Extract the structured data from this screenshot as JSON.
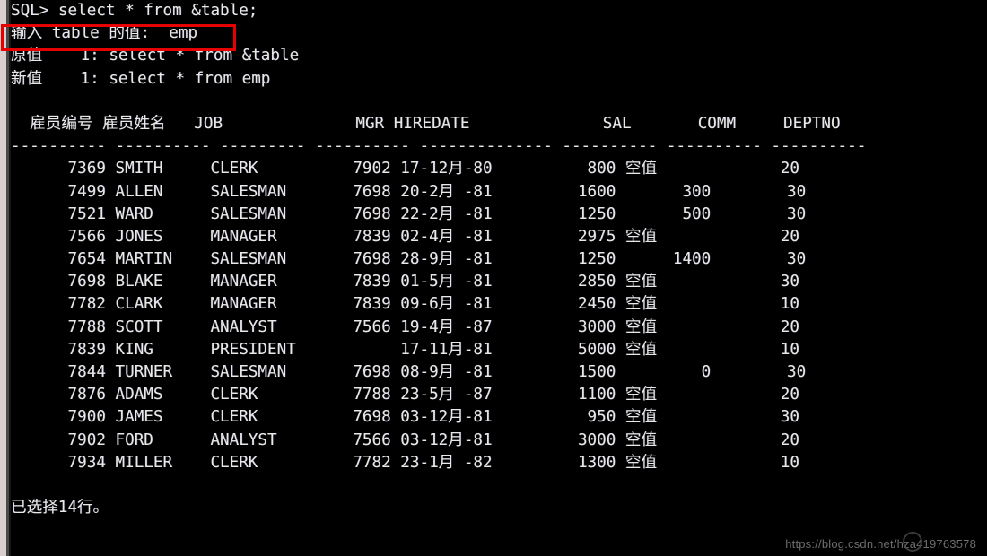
{
  "terminal": {
    "prompt_line": "SQL> select * from &table;",
    "substitution_prompt": "输入 table 的值:  emp",
    "old_value_line": "原值    1: select * from &table",
    "new_value_line": "新值    1: select * from emp",
    "blank_line": "",
    "status_line": "已选择14行。",
    "null_display": "空值",
    "background_color": "#000000",
    "text_color": "#e8e8e8",
    "highlight_color": "#e60000"
  },
  "table": {
    "columns": [
      {
        "name": "雇员编号",
        "width": 10,
        "align": "right"
      },
      {
        "name": "雇员姓名",
        "width": 10,
        "align": "left"
      },
      {
        "name": "JOB",
        "width": 9,
        "align": "left"
      },
      {
        "name": "MGR",
        "width": 10,
        "align": "right"
      },
      {
        "name": "HIREDATE",
        "width": 14,
        "align": "left"
      },
      {
        "name": "SAL",
        "width": 10,
        "align": "right"
      },
      {
        "name": "COMM",
        "width": 10,
        "align": "right"
      },
      {
        "name": "DEPTNO",
        "width": 10,
        "align": "right"
      }
    ],
    "separator": "---------- ---------- --------- ---------- -------------- ---------- ---------- ----------",
    "header_line": "  雇员编号 雇员姓名   JOB              MGR HIREDATE              SAL       COMM     DEPTNO",
    "rows": [
      {
        "empno": "7369",
        "ename": "SMITH",
        "job": "CLERK",
        "mgr": "7902",
        "hiredate": "17-12月-80",
        "sal": "800",
        "comm": "空值",
        "deptno": "20"
      },
      {
        "empno": "7499",
        "ename": "ALLEN",
        "job": "SALESMAN",
        "mgr": "7698",
        "hiredate": "20-2月 -81",
        "sal": "1600",
        "comm": "300",
        "deptno": "30"
      },
      {
        "empno": "7521",
        "ename": "WARD",
        "job": "SALESMAN",
        "mgr": "7698",
        "hiredate": "22-2月 -81",
        "sal": "1250",
        "comm": "500",
        "deptno": "30"
      },
      {
        "empno": "7566",
        "ename": "JONES",
        "job": "MANAGER",
        "mgr": "7839",
        "hiredate": "02-4月 -81",
        "sal": "2975",
        "comm": "空值",
        "deptno": "20"
      },
      {
        "empno": "7654",
        "ename": "MARTIN",
        "job": "SALESMAN",
        "mgr": "7698",
        "hiredate": "28-9月 -81",
        "sal": "1250",
        "comm": "1400",
        "deptno": "30"
      },
      {
        "empno": "7698",
        "ename": "BLAKE",
        "job": "MANAGER",
        "mgr": "7839",
        "hiredate": "01-5月 -81",
        "sal": "2850",
        "comm": "空值",
        "deptno": "30"
      },
      {
        "empno": "7782",
        "ename": "CLARK",
        "job": "MANAGER",
        "mgr": "7839",
        "hiredate": "09-6月 -81",
        "sal": "2450",
        "comm": "空值",
        "deptno": "10"
      },
      {
        "empno": "7788",
        "ename": "SCOTT",
        "job": "ANALYST",
        "mgr": "7566",
        "hiredate": "19-4月 -87",
        "sal": "3000",
        "comm": "空值",
        "deptno": "20"
      },
      {
        "empno": "7839",
        "ename": "KING",
        "job": "PRESIDENT",
        "mgr": "",
        "hiredate": "17-11月-81",
        "sal": "5000",
        "comm": "空值",
        "deptno": "10"
      },
      {
        "empno": "7844",
        "ename": "TURNER",
        "job": "SALESMAN",
        "mgr": "7698",
        "hiredate": "08-9月 -81",
        "sal": "1500",
        "comm": "0",
        "deptno": "30"
      },
      {
        "empno": "7876",
        "ename": "ADAMS",
        "job": "CLERK",
        "mgr": "7788",
        "hiredate": "23-5月 -87",
        "sal": "1100",
        "comm": "空值",
        "deptno": "20"
      },
      {
        "empno": "7900",
        "ename": "JAMES",
        "job": "CLERK",
        "mgr": "7698",
        "hiredate": "03-12月-81",
        "sal": "950",
        "comm": "空值",
        "deptno": "30"
      },
      {
        "empno": "7902",
        "ename": "FORD",
        "job": "ANALYST",
        "mgr": "7566",
        "hiredate": "03-12月-81",
        "sal": "3000",
        "comm": "空值",
        "deptno": "20"
      },
      {
        "empno": "7934",
        "ename": "MILLER",
        "job": "CLERK",
        "mgr": "7782",
        "hiredate": "23-1月 -82",
        "sal": "1300",
        "comm": "空值",
        "deptno": "10"
      }
    ],
    "row_count": 14
  },
  "watermark": {
    "url": "https://blog.csdn.net/hza419763578"
  }
}
